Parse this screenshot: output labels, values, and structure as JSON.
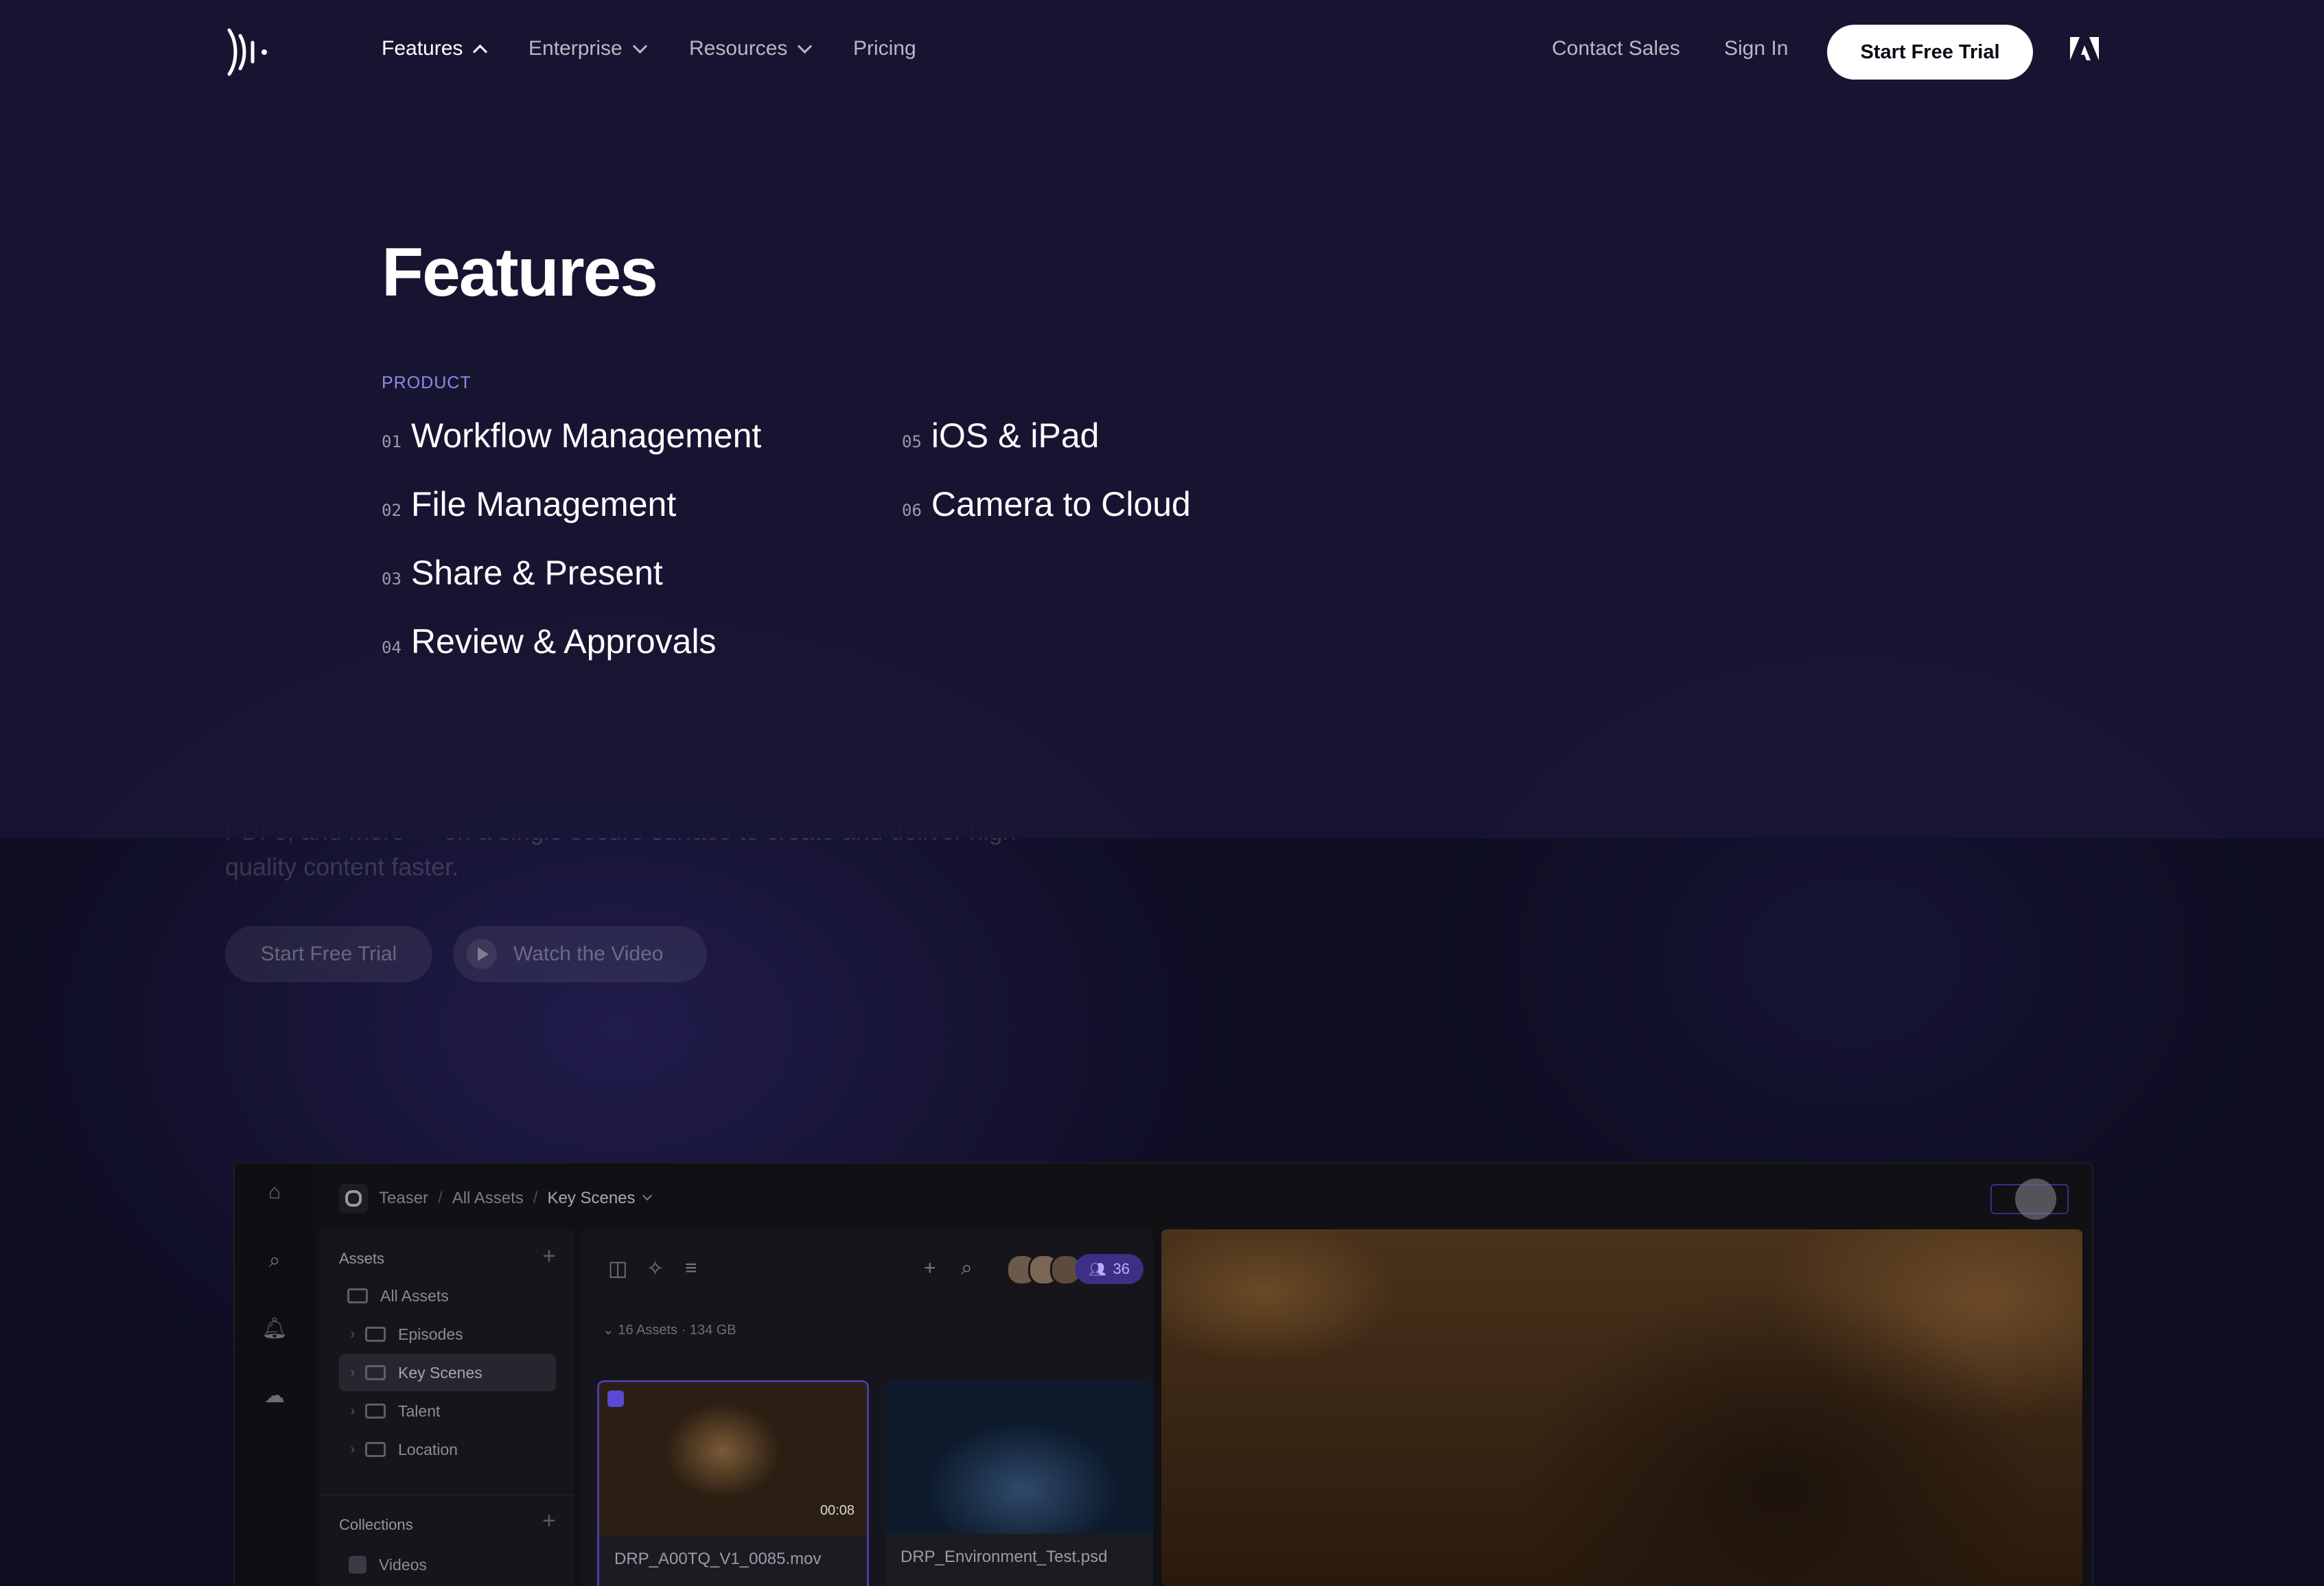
{
  "nav": {
    "items": [
      {
        "label": "Features"
      },
      {
        "label": "Enterprise"
      },
      {
        "label": "Resources"
      },
      {
        "label": "Pricing"
      }
    ],
    "contact_sales": "Contact Sales",
    "sign_in": "Sign In",
    "start_trial": "Start Free Trial"
  },
  "menu": {
    "title": "Features",
    "section_label": "PRODUCT",
    "items": [
      {
        "num": "01",
        "label": "Workflow Management"
      },
      {
        "num": "02",
        "label": "File Management"
      },
      {
        "num": "03",
        "label": "Share & Present"
      },
      {
        "num": "04",
        "label": "Review & Approvals"
      },
      {
        "num": "05",
        "label": "iOS & iPad"
      },
      {
        "num": "06",
        "label": "Camera to Cloud"
      }
    ]
  },
  "hero": {
    "description_line1": "PDFs, and more — on a single secure surface to create and deliver high-",
    "description_line2": "quality content faster.",
    "cta_trial": "Start Free Trial",
    "cta_video": "Watch the Video"
  },
  "app": {
    "breadcrumb": {
      "project": "Teaser",
      "level1": "All Assets",
      "current": "Key Scenes"
    },
    "sidebar": {
      "assets_heading": "Assets",
      "items": [
        {
          "label": "All Assets"
        },
        {
          "label": "Episodes"
        },
        {
          "label": "Key Scenes"
        },
        {
          "label": "Talent"
        },
        {
          "label": "Location"
        }
      ],
      "collections_heading": "Collections",
      "collections": [
        {
          "label": "Videos"
        }
      ]
    },
    "grid": {
      "member_count": "36",
      "assets_count": "16 Assets",
      "assets_size": "134 GB",
      "files": [
        {
          "name": "DRP_A00TQ_V1_0085.mov",
          "duration": "00:08"
        },
        {
          "name": "DRP_Environment_Test.psd"
        }
      ]
    }
  },
  "colors": {
    "accent": "#8f8ce6",
    "cta_bg": "#ffffff",
    "badge": "#3d2f86",
    "overlay": "#181634"
  }
}
